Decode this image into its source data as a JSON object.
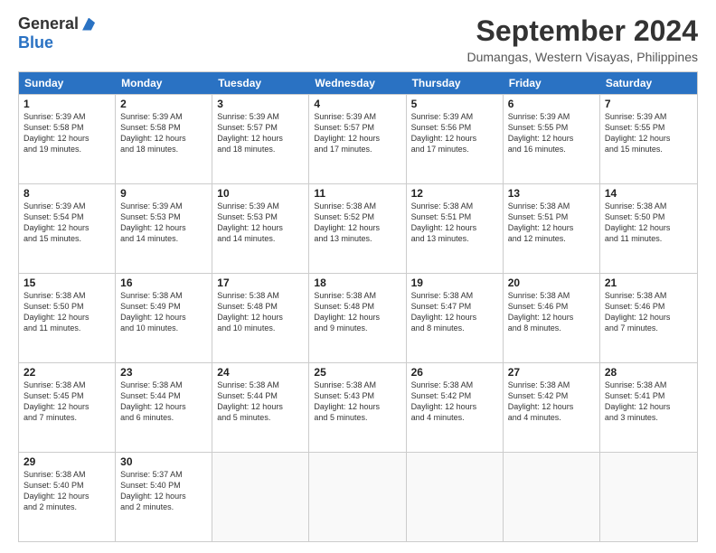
{
  "logo": {
    "general": "General",
    "blue": "Blue"
  },
  "title": "September 2024",
  "location": "Dumangas, Western Visayas, Philippines",
  "days": [
    "Sunday",
    "Monday",
    "Tuesday",
    "Wednesday",
    "Thursday",
    "Friday",
    "Saturday"
  ],
  "rows": [
    [
      {
        "day": "1",
        "lines": [
          "Sunrise: 5:39 AM",
          "Sunset: 5:58 PM",
          "Daylight: 12 hours",
          "and 19 minutes."
        ]
      },
      {
        "day": "2",
        "lines": [
          "Sunrise: 5:39 AM",
          "Sunset: 5:58 PM",
          "Daylight: 12 hours",
          "and 18 minutes."
        ]
      },
      {
        "day": "3",
        "lines": [
          "Sunrise: 5:39 AM",
          "Sunset: 5:57 PM",
          "Daylight: 12 hours",
          "and 18 minutes."
        ]
      },
      {
        "day": "4",
        "lines": [
          "Sunrise: 5:39 AM",
          "Sunset: 5:57 PM",
          "Daylight: 12 hours",
          "and 17 minutes."
        ]
      },
      {
        "day": "5",
        "lines": [
          "Sunrise: 5:39 AM",
          "Sunset: 5:56 PM",
          "Daylight: 12 hours",
          "and 17 minutes."
        ]
      },
      {
        "day": "6",
        "lines": [
          "Sunrise: 5:39 AM",
          "Sunset: 5:55 PM",
          "Daylight: 12 hours",
          "and 16 minutes."
        ]
      },
      {
        "day": "7",
        "lines": [
          "Sunrise: 5:39 AM",
          "Sunset: 5:55 PM",
          "Daylight: 12 hours",
          "and 15 minutes."
        ]
      }
    ],
    [
      {
        "day": "8",
        "lines": [
          "Sunrise: 5:39 AM",
          "Sunset: 5:54 PM",
          "Daylight: 12 hours",
          "and 15 minutes."
        ]
      },
      {
        "day": "9",
        "lines": [
          "Sunrise: 5:39 AM",
          "Sunset: 5:53 PM",
          "Daylight: 12 hours",
          "and 14 minutes."
        ]
      },
      {
        "day": "10",
        "lines": [
          "Sunrise: 5:39 AM",
          "Sunset: 5:53 PM",
          "Daylight: 12 hours",
          "and 14 minutes."
        ]
      },
      {
        "day": "11",
        "lines": [
          "Sunrise: 5:38 AM",
          "Sunset: 5:52 PM",
          "Daylight: 12 hours",
          "and 13 minutes."
        ]
      },
      {
        "day": "12",
        "lines": [
          "Sunrise: 5:38 AM",
          "Sunset: 5:51 PM",
          "Daylight: 12 hours",
          "and 13 minutes."
        ]
      },
      {
        "day": "13",
        "lines": [
          "Sunrise: 5:38 AM",
          "Sunset: 5:51 PM",
          "Daylight: 12 hours",
          "and 12 minutes."
        ]
      },
      {
        "day": "14",
        "lines": [
          "Sunrise: 5:38 AM",
          "Sunset: 5:50 PM",
          "Daylight: 12 hours",
          "and 11 minutes."
        ]
      }
    ],
    [
      {
        "day": "15",
        "lines": [
          "Sunrise: 5:38 AM",
          "Sunset: 5:50 PM",
          "Daylight: 12 hours",
          "and 11 minutes."
        ]
      },
      {
        "day": "16",
        "lines": [
          "Sunrise: 5:38 AM",
          "Sunset: 5:49 PM",
          "Daylight: 12 hours",
          "and 10 minutes."
        ]
      },
      {
        "day": "17",
        "lines": [
          "Sunrise: 5:38 AM",
          "Sunset: 5:48 PM",
          "Daylight: 12 hours",
          "and 10 minutes."
        ]
      },
      {
        "day": "18",
        "lines": [
          "Sunrise: 5:38 AM",
          "Sunset: 5:48 PM",
          "Daylight: 12 hours",
          "and 9 minutes."
        ]
      },
      {
        "day": "19",
        "lines": [
          "Sunrise: 5:38 AM",
          "Sunset: 5:47 PM",
          "Daylight: 12 hours",
          "and 8 minutes."
        ]
      },
      {
        "day": "20",
        "lines": [
          "Sunrise: 5:38 AM",
          "Sunset: 5:46 PM",
          "Daylight: 12 hours",
          "and 8 minutes."
        ]
      },
      {
        "day": "21",
        "lines": [
          "Sunrise: 5:38 AM",
          "Sunset: 5:46 PM",
          "Daylight: 12 hours",
          "and 7 minutes."
        ]
      }
    ],
    [
      {
        "day": "22",
        "lines": [
          "Sunrise: 5:38 AM",
          "Sunset: 5:45 PM",
          "Daylight: 12 hours",
          "and 7 minutes."
        ]
      },
      {
        "day": "23",
        "lines": [
          "Sunrise: 5:38 AM",
          "Sunset: 5:44 PM",
          "Daylight: 12 hours",
          "and 6 minutes."
        ]
      },
      {
        "day": "24",
        "lines": [
          "Sunrise: 5:38 AM",
          "Sunset: 5:44 PM",
          "Daylight: 12 hours",
          "and 5 minutes."
        ]
      },
      {
        "day": "25",
        "lines": [
          "Sunrise: 5:38 AM",
          "Sunset: 5:43 PM",
          "Daylight: 12 hours",
          "and 5 minutes."
        ]
      },
      {
        "day": "26",
        "lines": [
          "Sunrise: 5:38 AM",
          "Sunset: 5:42 PM",
          "Daylight: 12 hours",
          "and 4 minutes."
        ]
      },
      {
        "day": "27",
        "lines": [
          "Sunrise: 5:38 AM",
          "Sunset: 5:42 PM",
          "Daylight: 12 hours",
          "and 4 minutes."
        ]
      },
      {
        "day": "28",
        "lines": [
          "Sunrise: 5:38 AM",
          "Sunset: 5:41 PM",
          "Daylight: 12 hours",
          "and 3 minutes."
        ]
      }
    ],
    [
      {
        "day": "29",
        "lines": [
          "Sunrise: 5:38 AM",
          "Sunset: 5:40 PM",
          "Daylight: 12 hours",
          "and 2 minutes."
        ]
      },
      {
        "day": "30",
        "lines": [
          "Sunrise: 5:37 AM",
          "Sunset: 5:40 PM",
          "Daylight: 12 hours",
          "and 2 minutes."
        ]
      },
      {
        "day": "",
        "lines": []
      },
      {
        "day": "",
        "lines": []
      },
      {
        "day": "",
        "lines": []
      },
      {
        "day": "",
        "lines": []
      },
      {
        "day": "",
        "lines": []
      }
    ]
  ]
}
